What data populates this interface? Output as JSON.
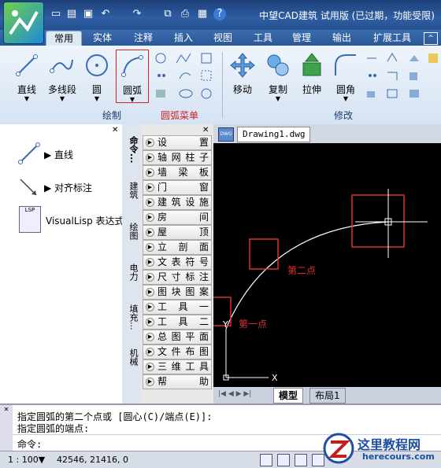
{
  "app": {
    "title": "中望CAD建筑 试用版 (已过期，功能受限)"
  },
  "ribbon_tabs": [
    "常用",
    "实体",
    "注释",
    "插入",
    "视图",
    "工具",
    "管理",
    "输出",
    "扩展工具"
  ],
  "ribbon": {
    "draw_buttons": [
      "直线",
      "多线段",
      "圆",
      "圆弧"
    ],
    "modify_buttons": [
      "移动",
      "复制",
      "拉伸",
      "圆角"
    ],
    "group_draw": "绘制",
    "group_arc_menu": "圆弧菜单",
    "group_modify": "修改"
  },
  "left_panel": {
    "items": [
      "直线",
      "对齐标注",
      "VisualLisp 表达式"
    ]
  },
  "side_tabs": [
    "命令...",
    "建筑",
    "绘图",
    "电力",
    "填充...",
    "机械"
  ],
  "commands": [
    "设置",
    "轴网柱子",
    "墙梁板",
    "门窗",
    "建筑设施",
    "房间",
    "屋顶",
    "立剖面",
    "文表符号",
    "尺寸标注",
    "图块图案",
    "工具一",
    "工具二",
    "总图平面",
    "文件布图",
    "三维工具",
    "帮助"
  ],
  "drawing": {
    "tab": "Drawing1.dwg",
    "label_second_point": "第二点",
    "label_first_point": "第一点",
    "axis_x": "X",
    "axis_y": "Y",
    "layout_tabs": [
      "模型",
      "布局1"
    ]
  },
  "command_line": {
    "line1": "指定圆弧的第二个点或 [圆心(C)/端点(E)]:",
    "line2": "指定圆弧的端点:",
    "prompt": "命令:"
  },
  "status": {
    "scale": "1 : 100▼",
    "coords": "42546, 21416, 0"
  },
  "watermark": {
    "name": "这里教程网",
    "url": "herecours.com"
  },
  "colors": {
    "accent": "#2a5898",
    "annotation": "#d02020",
    "arc": "#ffffff"
  }
}
